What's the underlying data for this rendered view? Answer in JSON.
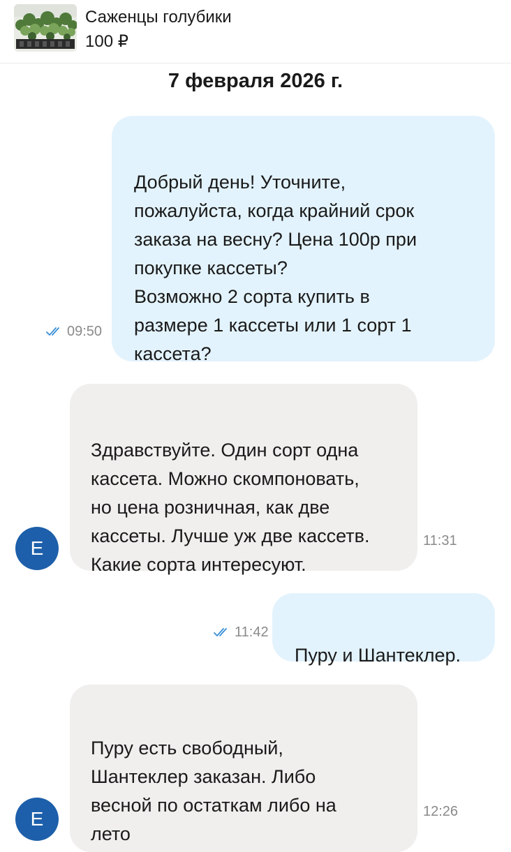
{
  "header": {
    "title": "Саженцы голубики",
    "price": "100 ₽"
  },
  "date_separator": "7 февраля 2026 г.",
  "messages": [
    {
      "direction": "outgoing",
      "text": "Добрый день! Уточните,\nпожалуйста, когда крайний срок\nзаказа на весну? Цена 100р при\nпокупке кассеты?\nВозможно 2 сорта купить в\nразмере 1 кассеты или 1 сорт 1\nкассета?",
      "time": "09:50",
      "status": "read"
    },
    {
      "direction": "incoming",
      "text": "Здравствуйте. Один сорт одна\nкассета. Можно скомпоновать,\nно цена розничная, как две\nкассеты. Лучше уж две кассетв.\nКакие сорта интересуют.",
      "time": "11:31",
      "avatar": "E"
    },
    {
      "direction": "outgoing",
      "text": "Пуру и Шантеклер.",
      "time": "11:42",
      "status": "read"
    },
    {
      "direction": "incoming",
      "text": "Пуру есть свободный,\nШантеклер заказан. Либо\nвесной по остаткам либо на\nлето",
      "time": "12:26",
      "avatar": "E"
    }
  ],
  "colors": {
    "outgoing_bubble": "#e3f3fd",
    "incoming_bubble": "#f0efee",
    "avatar": "#1d5faa",
    "read_ticks": "#3a8fd6"
  }
}
